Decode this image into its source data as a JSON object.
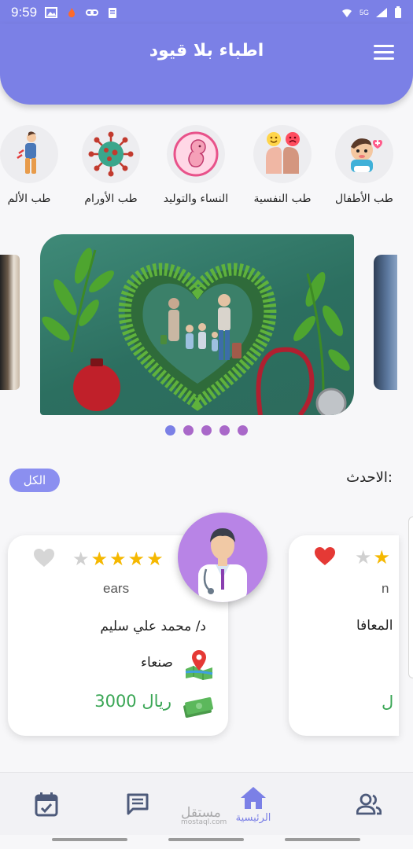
{
  "status_bar": {
    "time": "9:59",
    "signal_text": "5G"
  },
  "header": {
    "title": "اطباء بلا قيود",
    "accent_color": "#7b80e6"
  },
  "categories": [
    {
      "label": "طب الأطفال",
      "icon": "baby-icon"
    },
    {
      "label": "طب النفسية",
      "icon": "emotions-icon"
    },
    {
      "label": "النساء والتوليد",
      "icon": "fetus-icon"
    },
    {
      "label": "طب الأورام",
      "icon": "virus-icon"
    },
    {
      "label": "طب الألم",
      "icon": "back-pain-icon"
    }
  ],
  "carousel": {
    "dot_count": 5,
    "active_dot": 0
  },
  "latest": {
    "title": "الاحدث:",
    "all_button": "الكل"
  },
  "cards": [
    {
      "specialty": "ears",
      "name": "محمد علي سليم",
      "prefix": "د/",
      "city": "صنعاء",
      "price": "3000 ريال",
      "rating": 4,
      "favorite": false
    },
    {
      "specialty": "n",
      "name": "المعافا",
      "rating": 4,
      "favorite": true
    }
  ],
  "bottom_nav": {
    "home_label": "الرئيسية",
    "items": [
      "calendar-check-icon",
      "chat-icon",
      "home-icon",
      "people-icon"
    ]
  },
  "watermark": {
    "text": "مستقل",
    "sub": "mostaql.com"
  }
}
